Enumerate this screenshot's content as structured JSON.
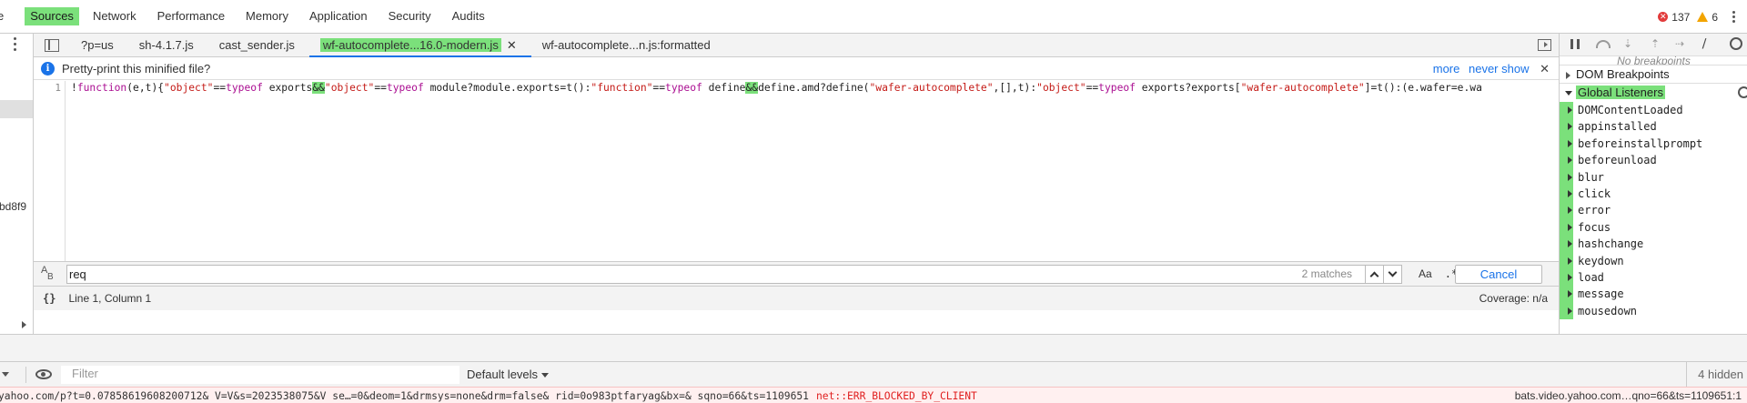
{
  "panel_tabs": [
    {
      "label": "e",
      "active": false
    },
    {
      "label": "Sources",
      "active": true
    },
    {
      "label": "Network",
      "active": false
    },
    {
      "label": "Performance",
      "active": false
    },
    {
      "label": "Memory",
      "active": false
    },
    {
      "label": "Application",
      "active": false
    },
    {
      "label": "Security",
      "active": false
    },
    {
      "label": "Audits",
      "active": false
    }
  ],
  "counts": {
    "errors": "137",
    "warnings": "6",
    "error_glyph": "✕"
  },
  "navigator": {
    "fragment": "bd8f9"
  },
  "file_tabs": [
    {
      "label": "?p=us"
    },
    {
      "label": "sh-4.1.7.js"
    },
    {
      "label": "cast_sender.js"
    },
    {
      "label": "wf-autocomplete...16.0-modern.js",
      "close": "✕"
    },
    {
      "label": "wf-autocomplete...n.js:formatted"
    }
  ],
  "infobar": {
    "message": "Pretty-print this minified file?",
    "more": "more",
    "never_show": "never show",
    "close": "✕",
    "icon_glyph": "i"
  },
  "code": {
    "line_number": "1",
    "t1": "!",
    "t2": "function",
    "t3": "(e,t){",
    "t4": "\"object\"",
    "t5": "==",
    "t6": "typeof",
    "t7": " exports",
    "t8": "&&",
    "t9": "\"object\"",
    "t10": "==",
    "t11": "typeof",
    "t12": " module?module.exports=t():",
    "t13": "\"function\"",
    "t14": "==",
    "t15": "typeof",
    "t16": " define",
    "t17": "&&",
    "t18": "define.amd?define(",
    "t19": "\"wafer-autocomplete\"",
    "t20": ",[],t):",
    "t21": "\"object\"",
    "t22": "==",
    "t23": "typeof",
    "t24": " exports?exports[",
    "t25": "\"wafer-autocomplete\"",
    "t26": "]=t():(e.wafer=e.wa"
  },
  "search": {
    "value": "req",
    "matches": "2 matches",
    "match_case": "Aa",
    "regex": ".*",
    "cancel": "Cancel",
    "case_icon_a": "A",
    "case_icon_b": "B"
  },
  "status": {
    "braces": "{}",
    "position": "Line 1, Column 1",
    "coverage": "Coverage: n/a"
  },
  "debugger": {
    "no_breakpoints": "No breakpoints",
    "dom_breakpoints": "DOM Breakpoints",
    "global_listeners": "Global Listeners",
    "step_down_glyph": "⇣",
    "step_up_glyph": "⇡",
    "step_glyph": "⇢",
    "deactivate_glyph": "⧸",
    "listeners": [
      "DOMContentLoaded",
      "appinstalled",
      "beforeinstallprompt",
      "beforeunload",
      "blur",
      "click",
      "error",
      "focus",
      "hashchange",
      "keydown",
      "load",
      "message",
      "mousedown"
    ]
  },
  "console": {
    "filter_placeholder": "Filter",
    "levels": "Default levels",
    "hidden": "4 hidden",
    "row_url": "yahoo.com/p?t=0.07858619608200712& V=V&s=2023538075&V se…=0&deom=1&drmsys=none&drm=false& rid=0o983ptfaryag&bx=& sqno=66&ts=1109651",
    "row_error": "net::ERR_BLOCKED_BY_CLIENT",
    "row_source": "bats.video.yahoo.com…qno=66&ts=1109651:1"
  },
  "colors": {
    "accent": "#1a73e8",
    "highlight": "#7be07b",
    "error": "#e02020",
    "warning": "#f2a400"
  }
}
